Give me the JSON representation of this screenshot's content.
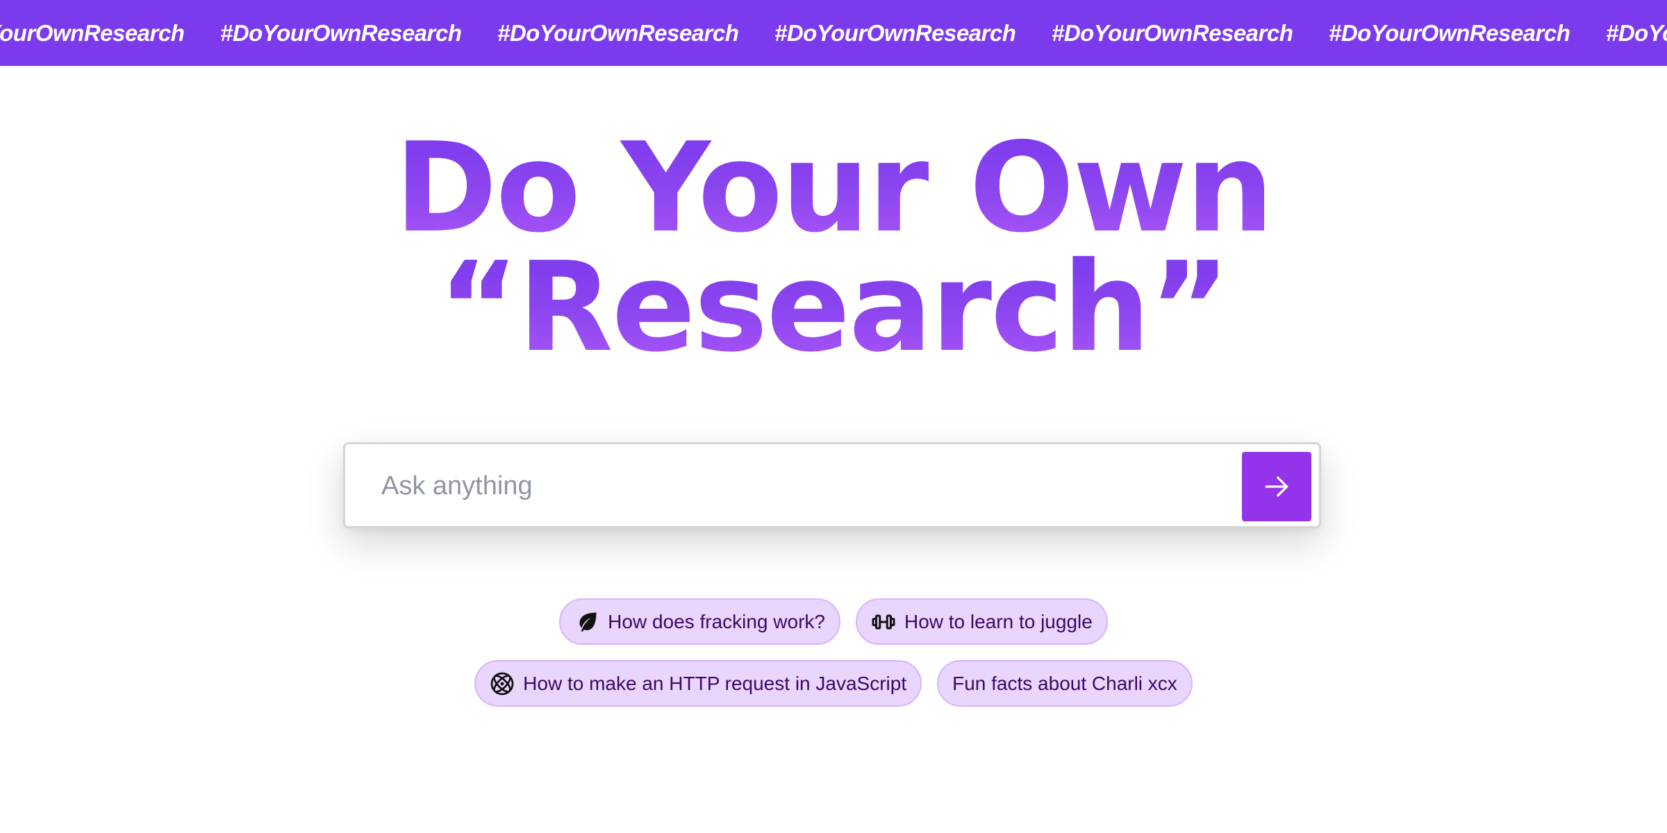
{
  "banner": {
    "hashtag_items": [
      "#DoYourOwnResearch",
      "#DoYourOwnResearch",
      "#DoYourOwnResearch",
      "#DoYourOwnResearch",
      "#DoYourOwnResearch",
      "#DoYourOwnResearch",
      "#DoYourOwnResearch"
    ],
    "background_color": "#7c3aed"
  },
  "hero": {
    "title_line_1": "Do Your Own",
    "title_line_2": "“Research”",
    "gradient_top_color": "#7c3aed",
    "gradient_bottom_color": "#a855f7"
  },
  "search": {
    "placeholder": "Ask anything",
    "value": "",
    "submit_icon": "arrow-right-icon",
    "submit_button_color": "#9333ea"
  },
  "suggestions": [
    {
      "label": "How does fracking work?",
      "icon": "leaf-icon"
    },
    {
      "label": "How to learn to juggle",
      "icon": "dumbbell-icon"
    },
    {
      "label": "How to make an HTTP request in JavaScript",
      "icon": "atom-icon"
    },
    {
      "label": "Fun facts about Charli xcx",
      "icon": ""
    }
  ]
}
